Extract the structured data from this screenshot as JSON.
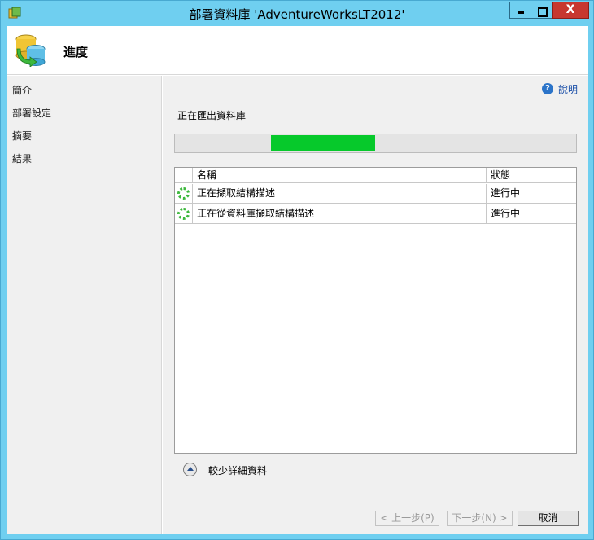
{
  "window": {
    "title": "部署資料庫 'AdventureWorksLT2012'",
    "close_glyph": "X"
  },
  "header": {
    "title": "進度"
  },
  "sidebar": {
    "items": [
      {
        "label": "簡介"
      },
      {
        "label": "部署設定"
      },
      {
        "label": "摘要"
      },
      {
        "label": "結果"
      }
    ]
  },
  "content": {
    "help_link": "說明",
    "help_glyph": "?",
    "status_label": "正在匯出資料庫",
    "progress": {
      "segment_start_fraction": 0.24,
      "segment_end_fraction": 0.5
    },
    "grid": {
      "columns": {
        "name": "名稱",
        "status": "狀態"
      },
      "rows": [
        {
          "name": "正在擷取結構描述",
          "status": "進行中",
          "icon": "spinner-icon"
        },
        {
          "name": "正在從資料庫擷取結構描述",
          "status": "進行中",
          "icon": "spinner-icon"
        }
      ]
    },
    "details_toggle_label": "較少詳細資料"
  },
  "footer": {
    "prev_label": "< 上一步(P)",
    "next_label": "下一步(N) >",
    "cancel_label": "取消"
  },
  "colors": {
    "titlebar": "#6fcff0",
    "progress_fill": "#06c92b",
    "close_button": "#c7372f"
  }
}
